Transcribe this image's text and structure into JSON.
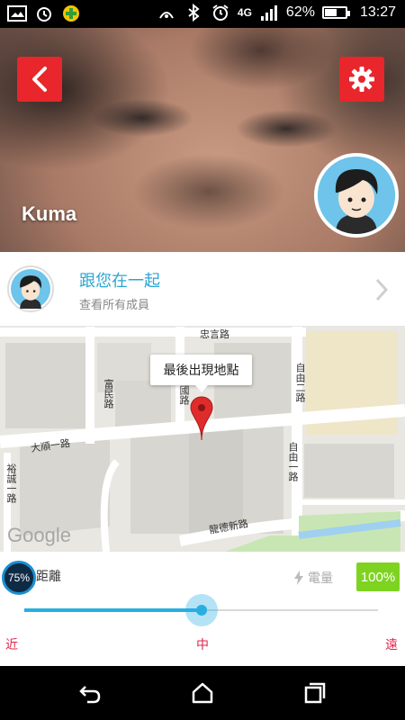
{
  "status_bar": {
    "battery_percent": "62%",
    "battery_level": 0.62,
    "time": "13:27",
    "network": "4G",
    "icons": [
      "gallery-icon",
      "alarm-icon",
      "app-icon",
      "nfc-icon",
      "bluetooth-icon",
      "alarm-clock-icon",
      "4g-icon",
      "signal-icon",
      "battery-icon"
    ]
  },
  "hero": {
    "member_name": "Kuma",
    "back_icon": "chevron-left-icon",
    "settings_icon": "gear-icon",
    "accent_color": "#e8262b"
  },
  "members": {
    "title": "跟您在一起",
    "subtitle": "查看所有成員"
  },
  "map": {
    "callout": "最後出現地點",
    "provider": "Google",
    "roads": [
      "忠言路",
      "富民路",
      "建國路",
      "自由二路",
      "大順一路",
      "自由一路",
      "龍德新路",
      "裕誠一路"
    ]
  },
  "distance": {
    "percent_label": "75%",
    "label": "距離",
    "power_label": "電量",
    "power_value": "100%",
    "slider_value": 0.5,
    "near": "近",
    "mid": "中",
    "far": "遠"
  },
  "navbar": {
    "icons": [
      "back-icon",
      "home-icon",
      "recent-apps-icon"
    ]
  }
}
